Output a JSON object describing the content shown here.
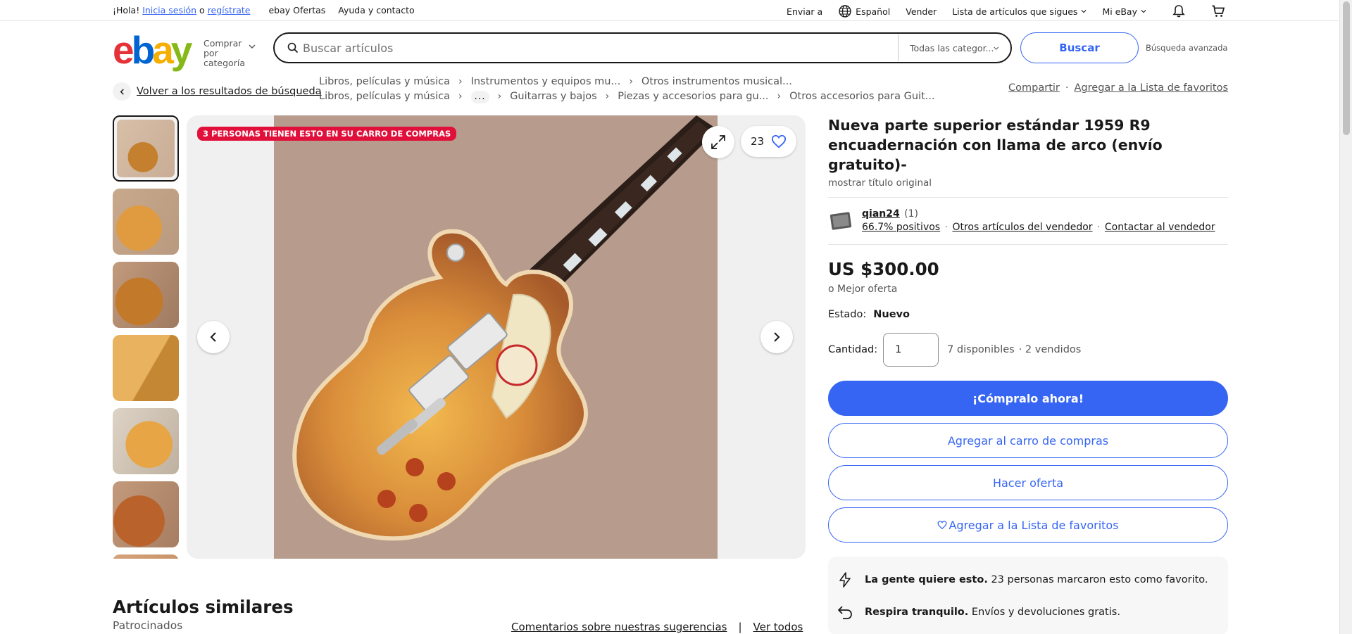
{
  "topbar": {
    "greeting": "¡Hola!",
    "signin": "Inicia sesión",
    "or": "o",
    "register": "regístrate",
    "deals": "ebay Ofertas",
    "help": "Ayuda y contacto",
    "ship_to": "Enviar a",
    "language": "Español",
    "sell": "Vender",
    "watchlist": "Lista de artículos que sigues",
    "my_ebay": "Mi eBay"
  },
  "header": {
    "shop_by_category": "Comprar por categoría",
    "search_placeholder": "Buscar artículos",
    "category_select": "Todas las categor...",
    "search_button": "Buscar",
    "advanced": "Búsqueda avanzada"
  },
  "breadcrumb": {
    "back": "Volver a los resultados de búsqueda",
    "row1": [
      "Libros, películas y música",
      "Instrumentos y equipos mu...",
      "Otros instrumentos musical..."
    ],
    "row2": [
      "Libros, películas y música",
      "Guitarras y bajos",
      "Piezas y accesorios para gu...",
      "Otros accesorios para Guit..."
    ],
    "dots": "...",
    "share": "Compartir",
    "separator": "·",
    "add_watchlist": "Agregar a la Lista de favoritos"
  },
  "gallery": {
    "badge": "3 PERSONAS TIENEN ESTO EN SU CARRO DE COMPRAS",
    "favorites_count": "23"
  },
  "item": {
    "title": "Nueva parte superior estándar 1959 R9 encuadernación con llama de arco (envío gratuito)-",
    "show_original": "mostrar título original",
    "seller_name": "qian24",
    "seller_count": "(1)",
    "seller_positive": "66.7% positivos",
    "seller_other": "Otros artículos del vendedor",
    "seller_contact": "Contactar al vendedor",
    "price": "US $300.00",
    "best_offer": "o Mejor oferta",
    "condition_label": "Estado:",
    "condition_value": "Nuevo",
    "quantity_label": "Cantidad:",
    "quantity_value": "1",
    "available": "7 disponibles",
    "sold": "· 2 vendidos",
    "buy_now": "¡Cómpralo ahora!",
    "add_cart": "Agregar al carro de compras",
    "make_offer": "Hacer oferta",
    "add_watchlist": "Agregar a la Lista de favoritos"
  },
  "signals": [
    {
      "bold": "La gente quiere esto.",
      "text": " 23 personas marcaron esto como favorito.",
      "icon": "lightning-icon"
    },
    {
      "bold": "Respira tranquilo.",
      "text": " Envíos y devoluciones gratis.",
      "icon": "return-icon"
    }
  ],
  "similar": {
    "title": "Artículos similares",
    "sponsored": "Patrocinados",
    "feedback": "Comentarios sobre nuestras sugerencias",
    "divider": "|",
    "see_all": "Ver todos"
  },
  "colors": {
    "accent": "#3665f3",
    "badge": "#e0103a"
  }
}
